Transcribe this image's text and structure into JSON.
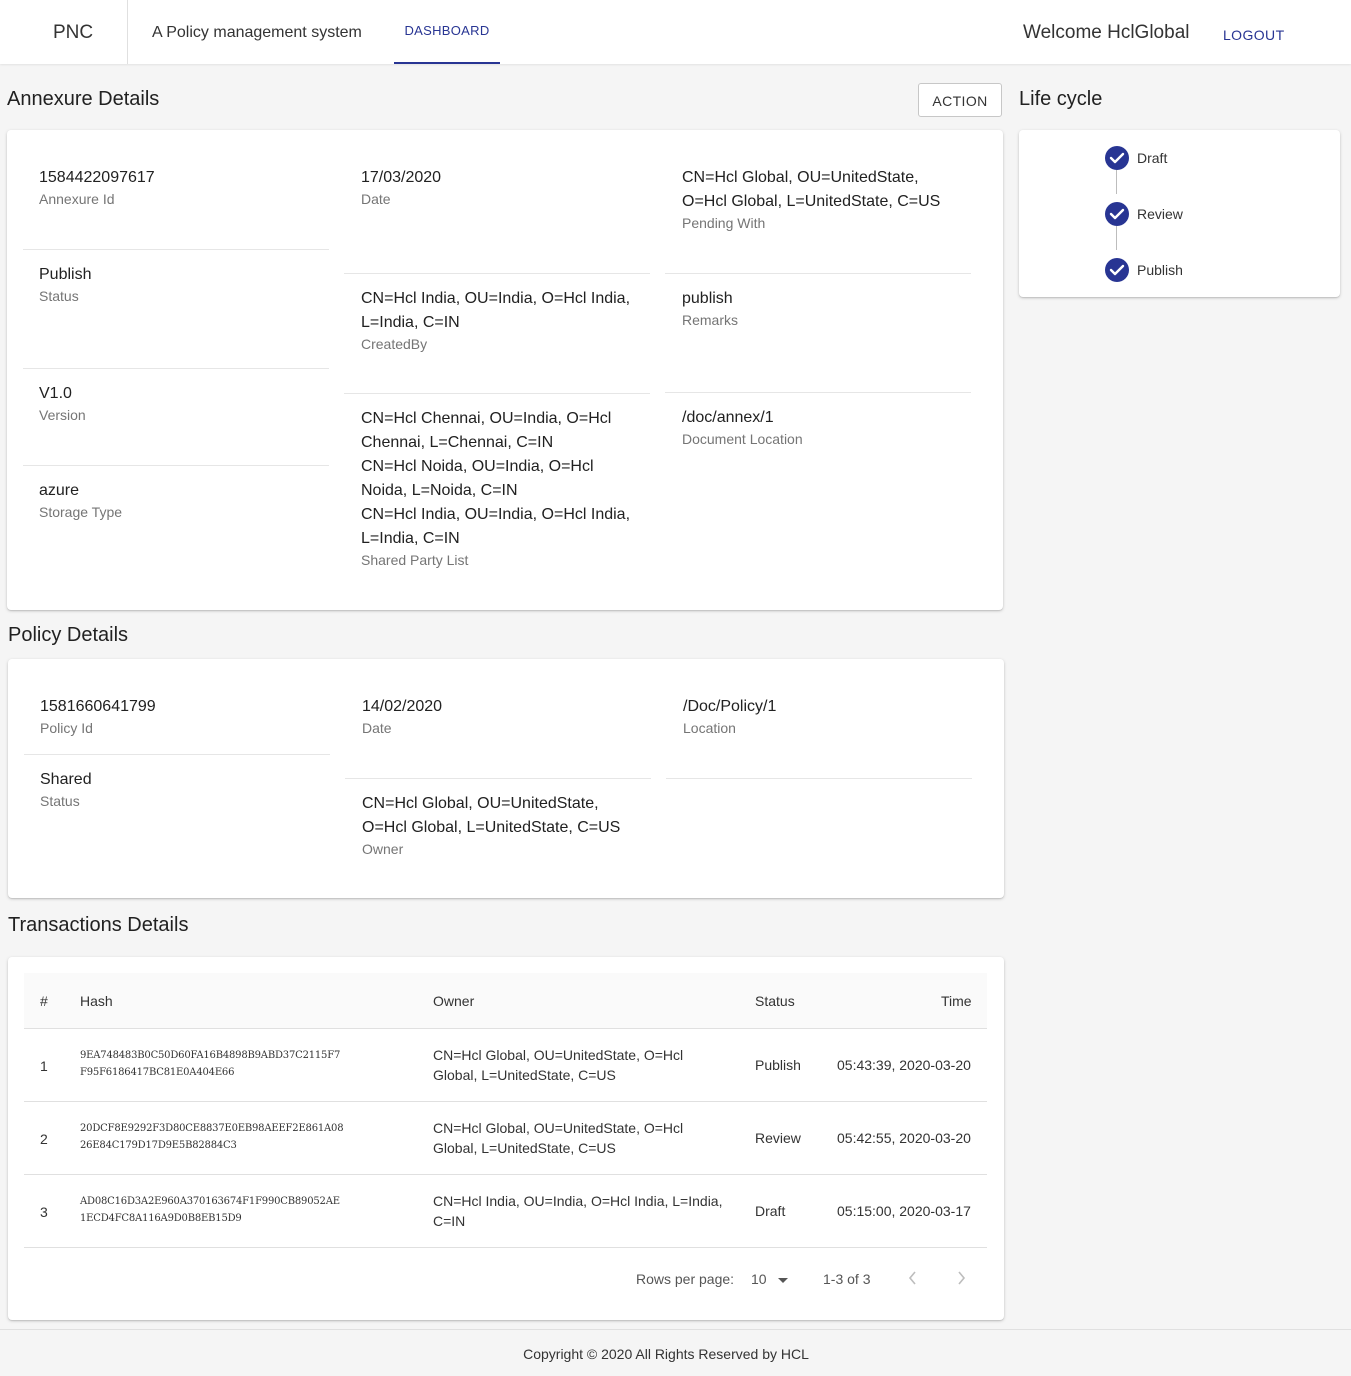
{
  "header": {
    "brand": "PNC",
    "subtitle": "A Policy management system",
    "nav_dashboard": "DASHBOARD",
    "welcome": "Welcome HclGlobal",
    "logout": "LOGOUT"
  },
  "annexure": {
    "title": "Annexure Details",
    "action_label": "ACTION",
    "fields": {
      "annexure_id": {
        "value": "1584422097617",
        "label": "Annexure Id"
      },
      "date": {
        "value": "17/03/2020",
        "label": "Date"
      },
      "pending_with": {
        "value_1": "CN=Hcl Global, OU=UnitedState,",
        "value_2": "O=Hcl Global, L=UnitedState, C=US",
        "label": "Pending With"
      },
      "status": {
        "value": "Publish",
        "label": "Status"
      },
      "created_by": {
        "value_1": "CN=Hcl India, OU=India, O=Hcl India,",
        "value_2": "L=India, C=IN",
        "label": "CreatedBy"
      },
      "remarks": {
        "value": "publish",
        "label": "Remarks"
      },
      "version": {
        "value": "V1.0",
        "label": "Version"
      },
      "shared_party_list": {
        "value_1": "CN=Hcl Chennai, OU=India, O=Hcl",
        "value_2": "Chennai, L=Chennai, C=IN",
        "value_3": "CN=Hcl Noida, OU=India, O=Hcl",
        "value_4": "Noida, L=Noida, C=IN",
        "value_5": "CN=Hcl India, OU=India, O=Hcl India,",
        "value_6": "L=India, C=IN",
        "label": "Shared Party List"
      },
      "document_location": {
        "value": "/doc/annex/1",
        "label": "Document Location"
      },
      "storage_type": {
        "value": "azure",
        "label": "Storage Type"
      }
    }
  },
  "lifecycle": {
    "title": "Life cycle",
    "steps": [
      "Draft",
      "Review",
      "Publish"
    ]
  },
  "policy": {
    "title": "Policy Details",
    "fields": {
      "policy_id": {
        "value": "1581660641799",
        "label": "Policy Id"
      },
      "date": {
        "value": "14/02/2020",
        "label": "Date"
      },
      "location": {
        "value": "/Doc/Policy/1",
        "label": "Location"
      },
      "status": {
        "value": "Shared",
        "label": "Status"
      },
      "owner": {
        "value_1": "CN=Hcl Global, OU=UnitedState,",
        "value_2": "O=Hcl Global, L=UnitedState, C=US",
        "label": "Owner"
      }
    }
  },
  "transactions": {
    "title": "Transactions Details",
    "columns": [
      "#",
      "Hash",
      "Owner",
      "Status",
      "Time"
    ],
    "rows": [
      {
        "num": "1",
        "hash_1": "9EA748483B0C50D60FA16B4898B9ABD37C2115F7",
        "hash_2": "F95F6186417BC81E0A404E66",
        "owner_1": "CN=Hcl Global, OU=UnitedState, O=Hcl",
        "owner_2": "Global, L=UnitedState, C=US",
        "status": "Publish",
        "time": "05:43:39, 2020-03-20"
      },
      {
        "num": "2",
        "hash_1": "20DCF8E9292F3D80CE8837E0EB98AEEF2E861A08",
        "hash_2": "26E84C179D17D9E5B82884C3",
        "owner_1": "CN=Hcl Global, OU=UnitedState, O=Hcl",
        "owner_2": "Global, L=UnitedState, C=US",
        "status": "Review",
        "time": "05:42:55, 2020-03-20"
      },
      {
        "num": "3",
        "hash_1": "AD08C16D3A2E960A370163674F1F990CB89052AE",
        "hash_2": "1ECD4FC8A116A9D0B8EB15D9",
        "owner_1": "CN=Hcl India, OU=India, O=Hcl India, L=India,",
        "owner_2": "C=IN",
        "status": "Draft",
        "time": "05:15:00, 2020-03-17"
      }
    ],
    "pagination": {
      "rows_per_page_label": "Rows per page:",
      "rows_per_page_value": "10",
      "range": "1-3 of 3"
    }
  },
  "footer": {
    "copyright": "Copyright © 2020 All Rights Reserved by HCL"
  },
  "colors": {
    "accent": "#283593",
    "background": "#f5f5f5",
    "card": "#ffffff",
    "label": "#757575"
  },
  "icons": [
    "check-circle-icon",
    "chevron-down-icon",
    "chevron-left-icon",
    "chevron-right-icon"
  ]
}
